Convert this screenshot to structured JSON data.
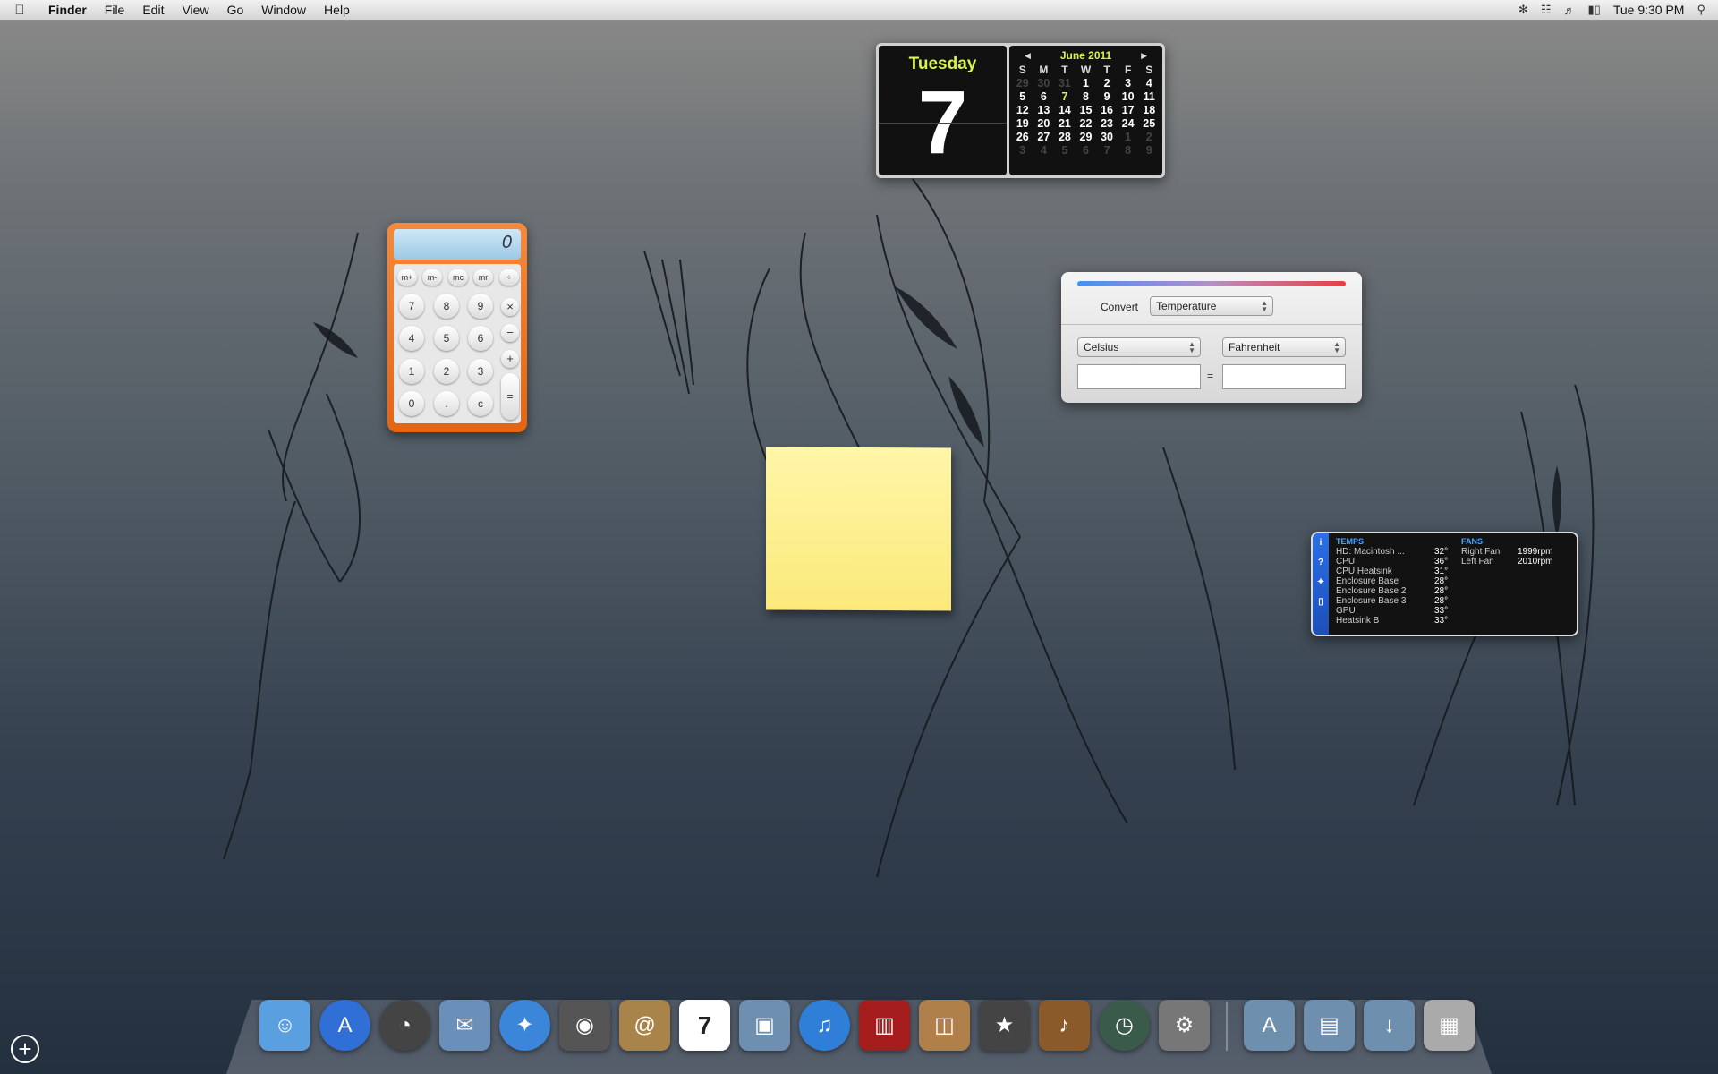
{
  "menubar": {
    "app_name": "Finder",
    "items": [
      "File",
      "Edit",
      "View",
      "Go",
      "Window",
      "Help"
    ],
    "clock": "Tue 9:30 PM"
  },
  "date_widget": {
    "weekday": "Tuesday",
    "day": "7",
    "month_label": "June 2011",
    "weekday_headers": [
      "S",
      "M",
      "T",
      "W",
      "T",
      "F",
      "S"
    ],
    "weeks": [
      [
        "29",
        "30",
        "31",
        "1",
        "2",
        "3",
        "4"
      ],
      [
        "5",
        "6",
        "7",
        "8",
        "9",
        "10",
        "11"
      ],
      [
        "12",
        "13",
        "14",
        "15",
        "16",
        "17",
        "18"
      ],
      [
        "19",
        "20",
        "21",
        "22",
        "23",
        "24",
        "25"
      ],
      [
        "26",
        "27",
        "28",
        "29",
        "30",
        "1",
        "2"
      ],
      [
        "3",
        "4",
        "5",
        "6",
        "7",
        "8",
        "9"
      ]
    ]
  },
  "calculator": {
    "display": "0",
    "memory_keys": [
      "m+",
      "m-",
      "mc",
      "mr",
      "÷"
    ],
    "keys": [
      "7",
      "8",
      "9",
      "4",
      "5",
      "6",
      "1",
      "2",
      "3",
      "0",
      ".",
      "c"
    ],
    "ops": [
      "×",
      "−",
      "+",
      "="
    ]
  },
  "converter": {
    "label": "Convert",
    "category": "Temperature",
    "from_unit": "Celsius",
    "to_unit": "Fahrenheit",
    "equals": "="
  },
  "istat": {
    "temps_title": "TEMPS",
    "fans_title": "FANS",
    "temps": [
      {
        "name": "HD: Macintosh ...",
        "value": "32°"
      },
      {
        "name": "CPU",
        "value": "36°"
      },
      {
        "name": "CPU Heatsink",
        "value": "31°"
      },
      {
        "name": "Enclosure Base",
        "value": "28°"
      },
      {
        "name": "Enclosure Base 2",
        "value": "28°"
      },
      {
        "name": "Enclosure Base 3",
        "value": "28°"
      },
      {
        "name": "GPU",
        "value": "33°"
      },
      {
        "name": "Heatsink B",
        "value": "33°"
      }
    ],
    "fans": [
      {
        "name": "Right Fan",
        "value": "1999rpm"
      },
      {
        "name": "Left Fan",
        "value": "2010rpm"
      }
    ]
  },
  "dock": {
    "apps": [
      {
        "icon": "finder-icon",
        "color": "#5aa0e0"
      },
      {
        "icon": "app-store-icon",
        "color": "#2f6fd6"
      },
      {
        "icon": "dashboard-icon",
        "color": "#444444"
      },
      {
        "icon": "mail-icon",
        "color": "#6a8fb8"
      },
      {
        "icon": "safari-icon",
        "color": "#3b86d8"
      },
      {
        "icon": "facetime-icon",
        "color": "#555555"
      },
      {
        "icon": "address-book-icon",
        "color": "#a8844a"
      },
      {
        "icon": "ical-icon",
        "color": "#ffffff"
      },
      {
        "icon": "iphoto-icon",
        "color": "#6e8fb0"
      },
      {
        "icon": "itunes-icon",
        "color": "#2f7fd8"
      },
      {
        "icon": "photo-booth-icon",
        "color": "#a51c1c"
      },
      {
        "icon": "image-capture-icon",
        "color": "#b0804a"
      },
      {
        "icon": "imovie-icon",
        "color": "#444444"
      },
      {
        "icon": "garageband-icon",
        "color": "#8a5a2a"
      },
      {
        "icon": "time-machine-icon",
        "color": "#3a5a4a"
      },
      {
        "icon": "system-preferences-icon",
        "color": "#777777"
      }
    ],
    "stacks": [
      {
        "icon": "applications-folder-icon",
        "color": "#6f8fae"
      },
      {
        "icon": "documents-folder-icon",
        "color": "#6f8fae"
      },
      {
        "icon": "downloads-folder-icon",
        "color": "#6f8fae"
      },
      {
        "icon": "trash-icon",
        "color": "#aaaaaa"
      }
    ],
    "ical_day": "7"
  }
}
